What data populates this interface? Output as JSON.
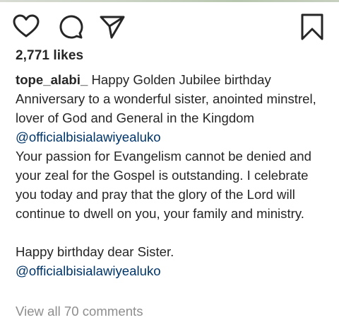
{
  "post": {
    "likes_text": "2,771 likes",
    "caption": {
      "username": "tope_alabi_",
      "text_1": " Happy Golden Jubilee birthday Anniversary to a wonderful sister, anointed minstrel, lover of God and General in the Kingdom ",
      "mention_1": "@officialbisialawiyealuko",
      "paragraph_2": "Your passion for Evangelism cannot be denied and your zeal for the Gospel is outstanding. I celebrate you today and pray that the glory of the Lord will continue to dwell on you, your family and ministry.",
      "paragraph_3": "Happy birthday dear Sister.",
      "mention_2": "@officialbisialawiyealuko"
    },
    "view_comments_text": "View all 70 comments"
  },
  "icons": {
    "like": "heart-icon",
    "comment": "comment-icon",
    "share": "paper-plane-icon",
    "save": "bookmark-icon"
  },
  "colors": {
    "text": "#262626",
    "mention": "#003569",
    "muted": "#8e8e8e"
  }
}
